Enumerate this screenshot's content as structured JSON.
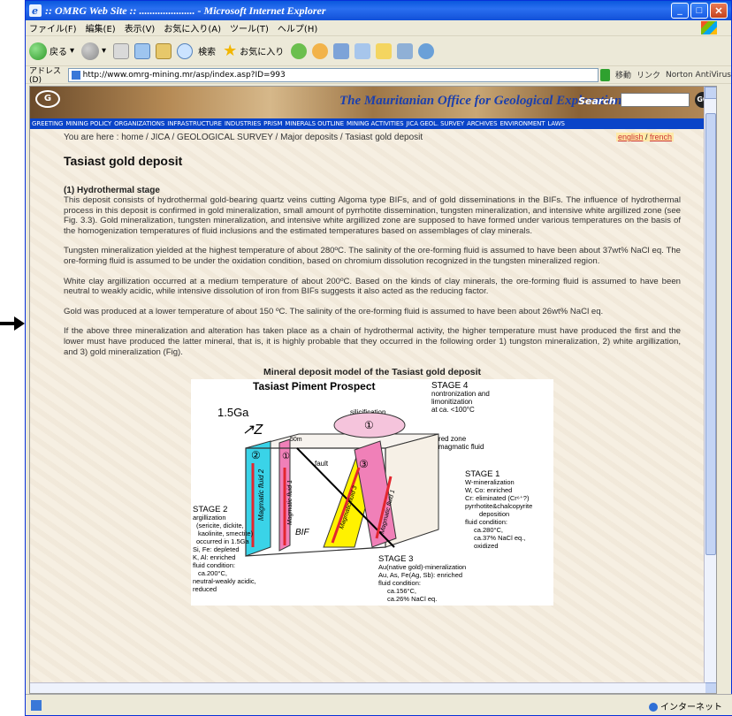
{
  "window": {
    "title": ":: OMRG Web Site :: ..................... - Microsoft Internet Explorer"
  },
  "menu": [
    "ファイル(F)",
    "編集(E)",
    "表示(V)",
    "お気に入り(A)",
    "ツール(T)",
    "ヘルプ(H)"
  ],
  "toolbar": {
    "back_label": "戻る",
    "search_label": "検索",
    "favorites_label": "お気に入り"
  },
  "address": {
    "label": "アドレス(D)",
    "url": "http://www.omrg-mining.mr/asp/index.asp?ID=993",
    "go_label": "移動",
    "links_label": "リンク",
    "norton_label": "Norton AntiVirus"
  },
  "site": {
    "logo_text": "G",
    "banner_title": "The Mauritanian Office for Geological Exploration",
    "search_label": "Search",
    "go_label": "GO",
    "nav": [
      "GREETING",
      "MINING POLICY",
      "ORGANIZATIONS",
      "INFRASTRUCTURE",
      "INDUSTRIES",
      "PRISM",
      "MINERALS OUTLINE",
      "MINING ACTIVITIES",
      "JICA GEOL. SURVEY",
      "ARCHIVES",
      "ENVIRONMENT",
      "LAWS"
    ]
  },
  "page": {
    "breadcrumb": "You are here : home / JICA / GEOLOGICAL SURVEY / Major deposits / Tasiast gold deposit",
    "lang_english": "english",
    "lang_sep": " / ",
    "lang_french": "french",
    "title": "Tasiast gold deposit",
    "section_title": "(1) Hydrothermal stage",
    "paragraphs": [
      "This deposit consists of hydrothermal gold-bearing quartz veins cutting Algoma type BIFs, and of gold disseminations in the BIFs. The influence of hydrothermal process in this deposit is confirmed in gold mineralization, small amount of pyrrhotite dissemination, tungsten mineralization, and intensive white argillized zone (see Fig. 3.3). Gold mineralization, tungsten mineralization, and intensive white argillized zone are supposed to have formed under various temperatures on the basis of the homogenization temperatures of fluid inclusions and the estimated temperatures based on assemblages of clay minerals.",
      "Tungsten mineralization yielded at the highest temperature of about 280ºC. The salinity of the ore-forming fluid is assumed to have been about 37wt% NaCl eq. The ore-forming fluid is assumed to be under the oxidation condition, based on chromium dissolution recognized in the tungsten mineralized region.",
      "White clay argillization occurred at a medium temperature of about 200ºC. Based on the kinds of clay minerals, the ore-forming fluid is assumed to have been neutral to weakly acidic, while intensive dissolution of iron from BIFs suggests it also acted as the reducing factor.",
      "Gold was produced at a lower temperature of about 150 ºC. The salinity of the ore-forming fluid is assumed to have been about 26wt% NaCl eq.",
      "If the above three mineralization and alteration has taken place as a chain of hydrothermal activity, the higher temperature must have produced the first and the lower must have produced the latter mineral, that is, it is highly probable that they occurred in the following order 1) tungston mineralization, 2) white argillization, and 3) gold mineralization (Fig)."
    ]
  },
  "figure": {
    "title": "Mineral deposit model of the Tasiast gold deposit",
    "subtitle": "Tasiast Piment Prospect",
    "age": "1.5Ga",
    "stage4": [
      "STAGE 4",
      "nontronization and",
      "limonitization",
      "at ca. <100°C"
    ],
    "silicification": "silicification",
    "weakly_sheared": [
      "weakly sheared zone",
      "=channel of magmatic fluid"
    ],
    "fault": "fault",
    "stage1": [
      "STAGE 1",
      "W-mineralization",
      "W, Co: enriched",
      "Cr: eliminated (Cr⁶⁺?)",
      "pyrrhotite&chalcopyrite",
      "deposition",
      "fluid condition:",
      "ca.280°C,",
      "ca.37% NaCl eq.,",
      "oxidized"
    ],
    "stage2": [
      "STAGE 2",
      "argillization",
      "(sericite, dickite,",
      "kaolinite, smectite)",
      "occurred in 1.5Ga",
      "Si, Fe: depleted",
      "K, Al: enriched",
      "fluid condition:",
      "ca.200°C,",
      "neutral-weakly acidic,",
      "reduced"
    ],
    "stage3": [
      "STAGE 3",
      "Au(native gold)-mineralization",
      "Au, As, Fe(Ag, Sb): enriched",
      "fluid condition:",
      "ca.156°C,",
      "ca.26% NaCl eq."
    ],
    "fluid_labels": [
      "Magmatic fluid 2",
      "Magmatic fluid 1",
      "Magmatic fluid 3",
      "Magmatic fluid 1"
    ],
    "bif": "BIF",
    "scale": "50m",
    "circles": [
      "①",
      "②",
      "③"
    ]
  },
  "status": {
    "zone": "インターネット"
  },
  "colors": {
    "cyan": "#3ad3e8",
    "pink": "#f080b8",
    "yellow": "#fff200",
    "arrow": "#e3262f"
  }
}
